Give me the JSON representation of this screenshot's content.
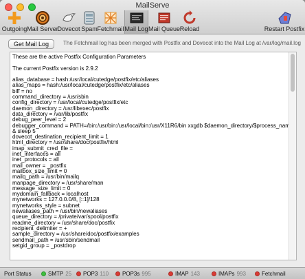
{
  "window": {
    "title": "MailServe"
  },
  "colors": {
    "green": "#3fbf3f",
    "red": "#d93a34",
    "amber": "#f0a81e",
    "close": "#ff5f57",
    "min": "#ffbd2e",
    "zoom": "#28c940"
  },
  "toolbar": [
    {
      "label": "Outgoing",
      "icon": "plus-icon"
    },
    {
      "label": "Mail Server",
      "icon": "gear-icon"
    },
    {
      "label": "Dovecot",
      "icon": "dove-icon"
    },
    {
      "label": "Spam",
      "icon": "spam-icon"
    },
    {
      "label": "Fetchmail",
      "icon": "fetchmail-icon"
    },
    {
      "label": "Mail Log",
      "icon": "mail-log-icon"
    },
    {
      "label": "Mail Queue",
      "icon": "mail-queue-icon"
    },
    {
      "label": "Reload",
      "icon": "reload-icon"
    },
    {
      "label": "Restart Postfix",
      "icon": "restart-icon"
    }
  ],
  "info": {
    "button": "Get Mail Log",
    "text": "The Fetchmail log has been merged with Postfix and Dovecot into the Mail Log at /var/log/mail.log"
  },
  "log_lines": [
    "These are the active Postfix Configuration Parameters",
    "",
    "The current Postfix version is 2.9.2",
    "",
    "alias_database = hash:/usr/local/cutedge/postfix/etc/aliases",
    "alias_maps = hash:/usr/local/cutedge/postfix/etc/aliases",
    "biff = no",
    "command_directory = /usr/sbin",
    "config_directory = /usr/local/cutedge/postfix/etc",
    "daemon_directory = /usr/libexec/postfix",
    "data_directory = /var/lib/postfix",
    "debug_peer_level = 2",
    "debugger_command = PATH=/bin:/usr/bin:/usr/local/bin:/usr/X11R6/bin xxgdb $daemon_directory/$process_name $process_",
    "& sleep 5",
    "dovecot_destination_recipient_limit = 1",
    "html_directory = /usr/share/doc/postfix/html",
    "imap_submit_cred_file =",
    "inet_interfaces = all",
    "inet_protocols = all",
    "mail_owner = _postfix",
    "mailbox_size_limit = 0",
    "mailq_path = /usr/bin/mailq",
    "manpage_directory = /usr/share/man",
    "message_size_limit = 0",
    "mydomain_fallback = localhost",
    "mynetworks = 127.0.0.0/8, [::1]/128",
    "mynetworks_style = subnet",
    "newaliases_path = /usr/bin/newaliases",
    "queue_directory = /private/var/spool/postfix",
    "readme_directory = /usr/share/doc/postfix",
    "recipient_delimiter = +",
    "sample_directory = /usr/share/doc/postfix/examples",
    "sendmail_path = /usr/sbin/sendmail",
    "setgid_group = _postdrop"
  ],
  "status": {
    "label": "Port Status",
    "items": [
      {
        "name": "SMTP",
        "port": "25",
        "color": "#3fbf3f"
      },
      {
        "name": "POP3",
        "port": "110",
        "color": "#d93a34"
      },
      {
        "name": "POP3s",
        "port": "995",
        "color": "#d93a34"
      },
      {
        "name": "IMAP",
        "port": "143",
        "color": "#d93a34"
      },
      {
        "name": "IMAPs",
        "port": "993",
        "color": "#d93a34"
      },
      {
        "name": "Fetchmail",
        "port": "",
        "color": "#d93a34"
      }
    ]
  }
}
